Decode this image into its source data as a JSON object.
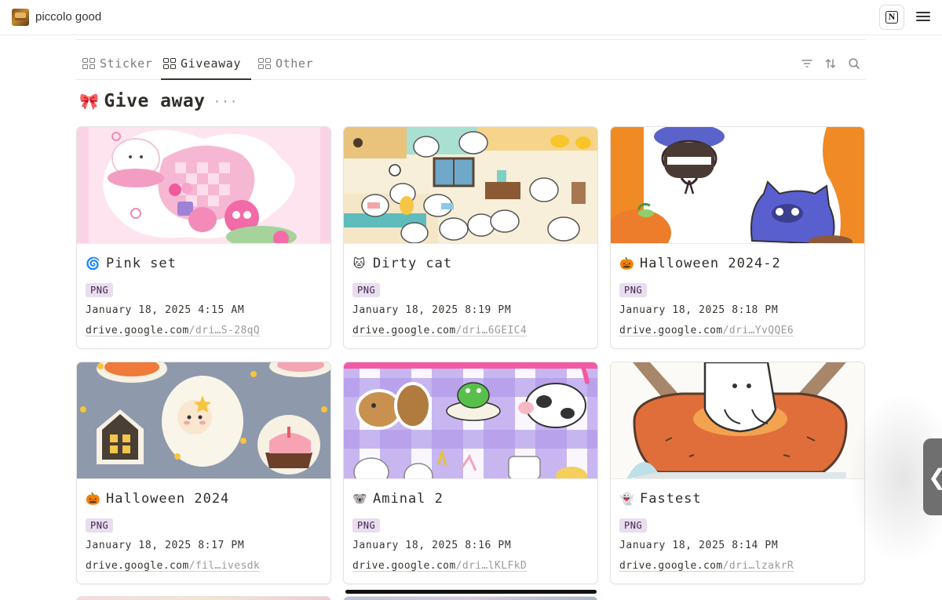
{
  "workspace": {
    "title": "piccolo good",
    "icon": "workspace-thumbnail-icon"
  },
  "header_actions": {
    "notion_icon": "notion-logo-icon",
    "menu_icon": "hamburger-menu-icon"
  },
  "tabs": [
    {
      "label": "Sticker",
      "icon": "gallery-view-icon",
      "active": false
    },
    {
      "label": "Giveaway",
      "icon": "gallery-view-icon",
      "active": true
    },
    {
      "label": "Other",
      "icon": "gallery-view-icon",
      "active": false
    }
  ],
  "toolbar": {
    "filter_icon": "filter-icon",
    "sort_icon": "sort-icon",
    "search_icon": "search-icon"
  },
  "database": {
    "emoji": "🎀",
    "title": "Give away",
    "more": "···"
  },
  "cards": [
    {
      "icon": "🌀",
      "title": "Pink set",
      "tag": "PNG",
      "date": "January 18, 2025 4:15 AM",
      "link_host": "drive.google.com",
      "link_path": "/dri…S-28qQ"
    },
    {
      "icon": "🐱",
      "title": "Dirty cat",
      "tag": "PNG",
      "date": "January 18, 2025 8:19 PM",
      "link_host": "drive.google.com",
      "link_path": "/dri…6GEIC4"
    },
    {
      "icon": "🎃",
      "title": "Halloween 2024-2",
      "tag": "PNG",
      "date": "January 18, 2025 8:18 PM",
      "link_host": "drive.google.com",
      "link_path": "/dri…YvQQE6"
    },
    {
      "icon": "🎃",
      "title": "Halloween 2024",
      "tag": "PNG",
      "date": "January 18, 2025 8:17 PM",
      "link_host": "drive.google.com",
      "link_path": "/fil…ivesdk"
    },
    {
      "icon": "🐨",
      "title": "Aminal 2",
      "tag": "PNG",
      "date": "January 18, 2025 8:16 PM",
      "link_host": "drive.google.com",
      "link_path": "/dri…lKLFkD"
    },
    {
      "icon": "👻",
      "title": "Fastest",
      "tag": "PNG",
      "date": "January 18, 2025 8:14 PM",
      "link_host": "drive.google.com",
      "link_path": "/dri…lzakrR"
    }
  ],
  "side_tab": {
    "glyph": "❮"
  },
  "colors": {
    "tag_bg": "#e8deee",
    "tag_text": "#412454",
    "accent_text": "#37352f"
  }
}
